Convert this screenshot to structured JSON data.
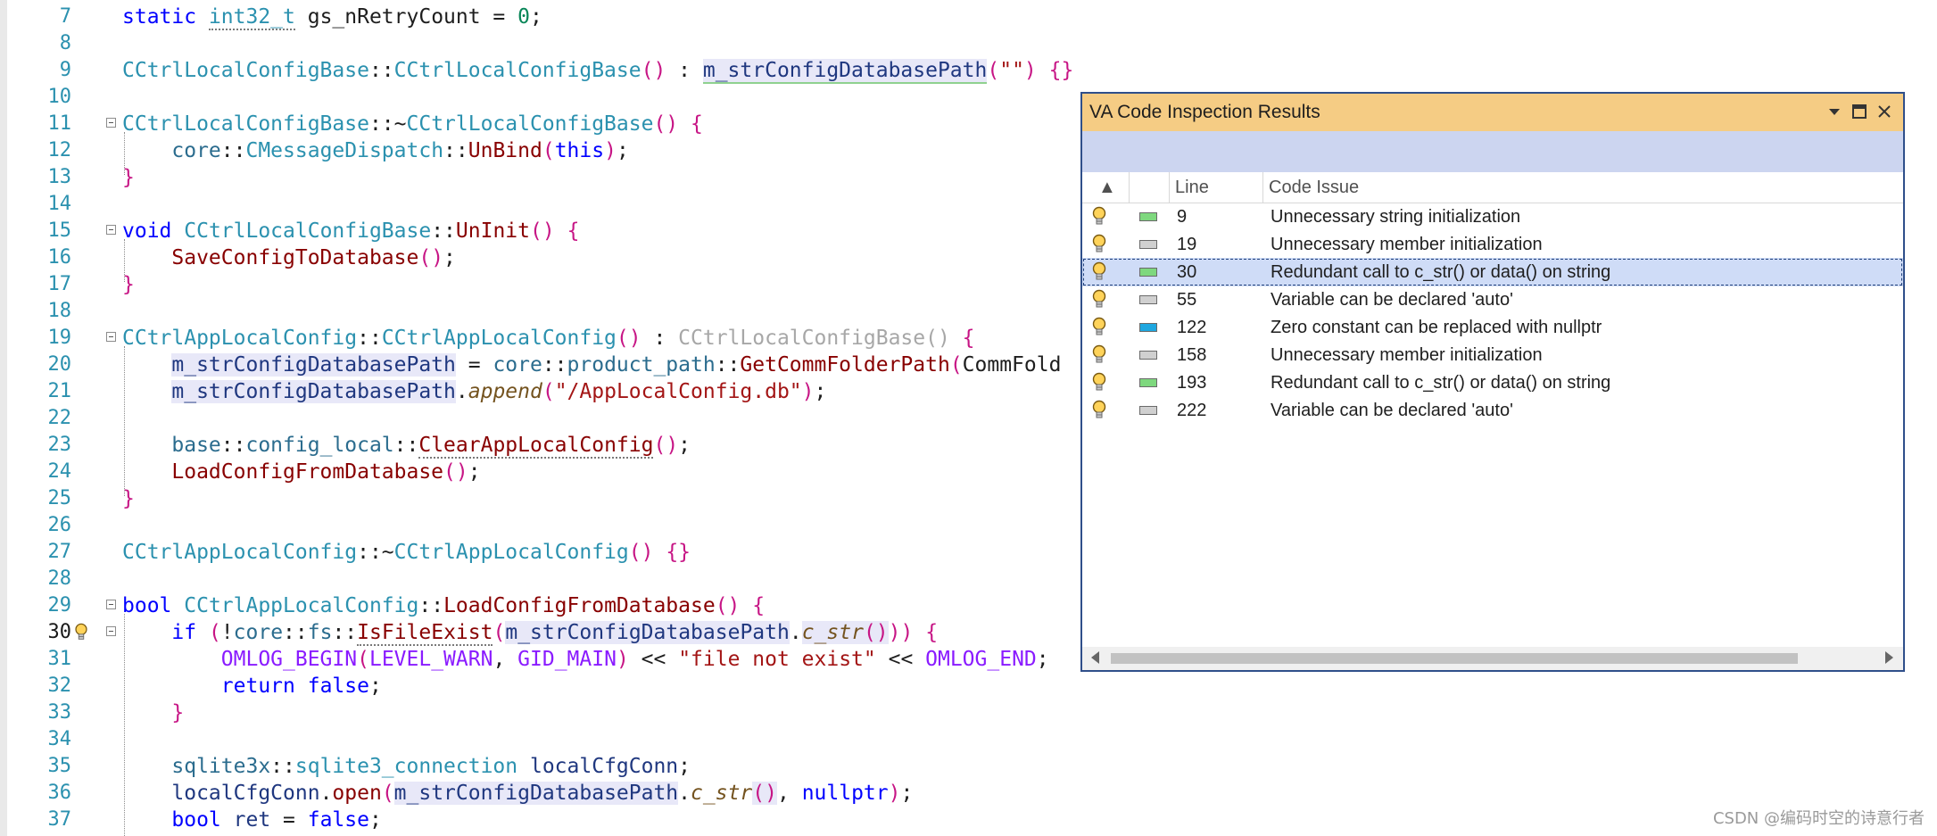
{
  "editor": {
    "lines": [
      {
        "n": "7",
        "tokens": [
          [
            "kw",
            "static "
          ],
          [
            "ty",
            "int32_t",
            [
              "ul"
            ]
          ],
          [
            "p",
            " gs_nRetryCount = "
          ],
          [
            "num",
            "0"
          ],
          [
            "p",
            ";"
          ]
        ]
      },
      {
        "n": "8",
        "tokens": []
      },
      {
        "n": "9",
        "tokens": [
          [
            "ty",
            "CCtrlLocalConfigBase"
          ],
          [
            "p",
            "::"
          ],
          [
            "ty",
            "CCtrlLocalConfigBase"
          ],
          [
            "brk",
            "()"
          ],
          [
            "p",
            " : "
          ],
          [
            "mem",
            "m_strConfigDatabasePath",
            [
              "hl",
              "ulg"
            ]
          ],
          [
            "brk",
            "("
          ],
          [
            "str",
            "\"\""
          ],
          [
            "brk",
            ")"
          ],
          [
            "p",
            " "
          ],
          [
            "brk",
            "{}"
          ]
        ]
      },
      {
        "n": "10",
        "tokens": []
      },
      {
        "n": "11",
        "fold": true,
        "tokens": [
          [
            "ty",
            "CCtrlLocalConfigBase"
          ],
          [
            "p",
            "::~"
          ],
          [
            "ty",
            "CCtrlLocalConfigBase"
          ],
          [
            "brk",
            "()"
          ],
          [
            "p",
            " "
          ],
          [
            "brk",
            "{"
          ]
        ]
      },
      {
        "n": "12",
        "tokens": [
          [
            "p",
            "    "
          ],
          [
            "ns",
            "core"
          ],
          [
            "p",
            "::"
          ],
          [
            "ty",
            "CMessageDispatch"
          ],
          [
            "p",
            "::"
          ],
          [
            "fnd",
            "UnBind"
          ],
          [
            "brk",
            "("
          ],
          [
            "kw",
            "this"
          ],
          [
            "brk",
            ")"
          ],
          [
            "p",
            ";"
          ]
        ]
      },
      {
        "n": "13",
        "tokens": [
          [
            "brk",
            "}"
          ]
        ]
      },
      {
        "n": "14",
        "tokens": []
      },
      {
        "n": "15",
        "fold": true,
        "tokens": [
          [
            "kw",
            "void "
          ],
          [
            "ty",
            "CCtrlLocalConfigBase"
          ],
          [
            "p",
            "::"
          ],
          [
            "fnd",
            "UnInit"
          ],
          [
            "brk",
            "()"
          ],
          [
            "p",
            " "
          ],
          [
            "brk",
            "{"
          ]
        ]
      },
      {
        "n": "16",
        "tokens": [
          [
            "p",
            "    "
          ],
          [
            "fnd",
            "SaveConfigToDatabase"
          ],
          [
            "brk",
            "()"
          ],
          [
            "p",
            ";"
          ]
        ]
      },
      {
        "n": "17",
        "tokens": [
          [
            "brk",
            "}"
          ]
        ]
      },
      {
        "n": "18",
        "tokens": []
      },
      {
        "n": "19",
        "fold": true,
        "tokens": [
          [
            "ty",
            "CCtrlAppLocalConfig"
          ],
          [
            "p",
            "::"
          ],
          [
            "ty",
            "CCtrlAppLocalConfig"
          ],
          [
            "brk",
            "()"
          ],
          [
            "p",
            " : "
          ],
          [
            "dim",
            "CCtrlLocalConfigBase()"
          ],
          [
            "p",
            " "
          ],
          [
            "brk",
            "{"
          ]
        ]
      },
      {
        "n": "20",
        "tokens": [
          [
            "p",
            "    "
          ],
          [
            "mem",
            "m_strConfigDatabasePath",
            [
              "hl"
            ]
          ],
          [
            "p",
            " = "
          ],
          [
            "ns",
            "core"
          ],
          [
            "p",
            "::"
          ],
          [
            "ns",
            "product_path"
          ],
          [
            "p",
            "::"
          ],
          [
            "fnd",
            "GetCommFolderPath"
          ],
          [
            "brk",
            "("
          ],
          [
            "p",
            "CommFold"
          ]
        ]
      },
      {
        "n": "21",
        "tokens": [
          [
            "p",
            "    "
          ],
          [
            "mem",
            "m_strConfigDatabasePath",
            [
              "hl"
            ]
          ],
          [
            "p",
            "."
          ],
          [
            "fn",
            "append",
            [
              "it"
            ]
          ],
          [
            "brk",
            "("
          ],
          [
            "str",
            "\"/AppLocalConfig.db\""
          ],
          [
            "brk",
            ")"
          ],
          [
            "p",
            ";"
          ]
        ]
      },
      {
        "n": "22",
        "tokens": []
      },
      {
        "n": "23",
        "tokens": [
          [
            "p",
            "    "
          ],
          [
            "ns",
            "base"
          ],
          [
            "p",
            "::"
          ],
          [
            "ns",
            "config_local"
          ],
          [
            "p",
            "::"
          ],
          [
            "fnd",
            "ClearAppLocalConfig",
            [
              "ul"
            ]
          ],
          [
            "brk",
            "()"
          ],
          [
            "p",
            ";"
          ]
        ]
      },
      {
        "n": "24",
        "tokens": [
          [
            "p",
            "    "
          ],
          [
            "fnd",
            "LoadConfigFromDatabase"
          ],
          [
            "brk",
            "()"
          ],
          [
            "p",
            ";"
          ]
        ]
      },
      {
        "n": "25",
        "tokens": [
          [
            "brk",
            "}"
          ]
        ]
      },
      {
        "n": "26",
        "tokens": []
      },
      {
        "n": "27",
        "tokens": [
          [
            "ty",
            "CCtrlAppLocalConfig"
          ],
          [
            "p",
            "::~"
          ],
          [
            "ty",
            "CCtrlAppLocalConfig"
          ],
          [
            "brk",
            "()"
          ],
          [
            "p",
            " "
          ],
          [
            "brk",
            "{}"
          ]
        ]
      },
      {
        "n": "28",
        "tokens": []
      },
      {
        "n": "29",
        "fold": true,
        "tokens": [
          [
            "kw",
            "bool "
          ],
          [
            "ty",
            "CCtrlAppLocalConfig"
          ],
          [
            "p",
            "::"
          ],
          [
            "fnd",
            "LoadConfigFromDatabase"
          ],
          [
            "brk",
            "()"
          ],
          [
            "p",
            " "
          ],
          [
            "brk",
            "{"
          ]
        ]
      },
      {
        "n": "30",
        "current": true,
        "bulb": true,
        "fold": true,
        "tokens": [
          [
            "p",
            "    "
          ],
          [
            "kw",
            "if "
          ],
          [
            "brk",
            "("
          ],
          [
            "p",
            "!"
          ],
          [
            "ns",
            "core"
          ],
          [
            "p",
            "::"
          ],
          [
            "ns",
            "fs"
          ],
          [
            "p",
            "::"
          ],
          [
            "fnd",
            "IsFileExist",
            [
              "ul"
            ]
          ],
          [
            "brk",
            "("
          ],
          [
            "mem",
            "m_strConfigDatabasePath",
            [
              "hl"
            ]
          ],
          [
            "p",
            "."
          ],
          [
            "fn",
            "c_str",
            [
              "it",
              "hl"
            ]
          ],
          [
            "brk",
            "()",
            [
              "hl"
            ]
          ],
          [
            "brk",
            "))"
          ],
          [
            "p",
            " "
          ],
          [
            "brk",
            "{"
          ]
        ]
      },
      {
        "n": "31",
        "tokens": [
          [
            "p",
            "        "
          ],
          [
            "mac",
            "OMLOG_BEGIN"
          ],
          [
            "brk",
            "("
          ],
          [
            "mac",
            "LEVEL_WARN"
          ],
          [
            "p",
            ", "
          ],
          [
            "mac",
            "GID_MAIN"
          ],
          [
            "brk",
            ")"
          ],
          [
            "p",
            " << "
          ],
          [
            "str",
            "\"file not exist\""
          ],
          [
            "p",
            " << "
          ],
          [
            "mac",
            "OMLOG_END"
          ],
          [
            "p",
            ";"
          ]
        ]
      },
      {
        "n": "32",
        "tokens": [
          [
            "p",
            "        "
          ],
          [
            "kw",
            "return "
          ],
          [
            "kw",
            "false"
          ],
          [
            "p",
            ";"
          ]
        ]
      },
      {
        "n": "33",
        "tokens": [
          [
            "p",
            "    "
          ],
          [
            "brk",
            "}"
          ]
        ]
      },
      {
        "n": "34",
        "tokens": []
      },
      {
        "n": "35",
        "tokens": [
          [
            "p",
            "    "
          ],
          [
            "ns",
            "sqlite3x"
          ],
          [
            "p",
            "::"
          ],
          [
            "ty",
            "sqlite3_connection"
          ],
          [
            "p",
            " "
          ],
          [
            "mem",
            "localCfgConn"
          ],
          [
            "p",
            ";"
          ]
        ]
      },
      {
        "n": "36",
        "tokens": [
          [
            "p",
            "    "
          ],
          [
            "mem",
            "localCfgConn"
          ],
          [
            "p",
            "."
          ],
          [
            "fnd",
            "open"
          ],
          [
            "brk",
            "("
          ],
          [
            "mem",
            "m_strConfigDatabasePath",
            [
              "hl"
            ]
          ],
          [
            "p",
            "."
          ],
          [
            "fn",
            "c_str",
            [
              "it"
            ]
          ],
          [
            "brk",
            "()",
            [
              "hl"
            ]
          ],
          [
            "p",
            ", "
          ],
          [
            "kw",
            "nullptr"
          ],
          [
            "brk",
            ")"
          ],
          [
            "p",
            ";"
          ]
        ]
      },
      {
        "n": "37",
        "tokens": [
          [
            "p",
            "    "
          ],
          [
            "kw",
            "bool "
          ],
          [
            "mem",
            "ret"
          ],
          [
            "p",
            " = "
          ],
          [
            "kw",
            "false"
          ],
          [
            "p",
            ";"
          ]
        ]
      }
    ]
  },
  "panel": {
    "title": "VA Code Inspection Results",
    "columns": {
      "sort_glyph": "▲",
      "line": "Line",
      "issue": "Code Issue"
    },
    "rows": [
      {
        "line": "9",
        "issue": "Unnecessary string initialization",
        "severity_color": "#7ed87e",
        "selected": false
      },
      {
        "line": "19",
        "issue": "Unnecessary member initialization",
        "severity_color": "#d0d0d0",
        "selected": false
      },
      {
        "line": "30",
        "issue": "Redundant call to c_str() or data() on string",
        "severity_color": "#7ed87e",
        "selected": true
      },
      {
        "line": "55",
        "issue": "Variable can be declared 'auto'",
        "severity_color": "#d0d0d0",
        "selected": false
      },
      {
        "line": "122",
        "issue": "Zero constant can be replaced with nullptr",
        "severity_color": "#1ea7e0",
        "selected": false
      },
      {
        "line": "158",
        "issue": "Unnecessary member initialization",
        "severity_color": "#d0d0d0",
        "selected": false
      },
      {
        "line": "193",
        "issue": "Redundant call to c_str() or data() on string",
        "severity_color": "#7ed87e",
        "selected": false
      },
      {
        "line": "222",
        "issue": "Variable can be declared 'auto'",
        "severity_color": "#d0d0d0",
        "selected": false
      }
    ],
    "icons": {
      "dropdown": "chevron-down-icon",
      "maximize": "maximize-icon",
      "close": "close-icon",
      "row": "lightbulb-icon"
    }
  },
  "watermark": "CSDN @编码时空的诗意行者",
  "colors": {
    "title_bar": "#f5cc84",
    "toolbar": "#ccd5f0",
    "panel_border": "#2f4f8a",
    "selected_row": "#cfdcf7"
  }
}
